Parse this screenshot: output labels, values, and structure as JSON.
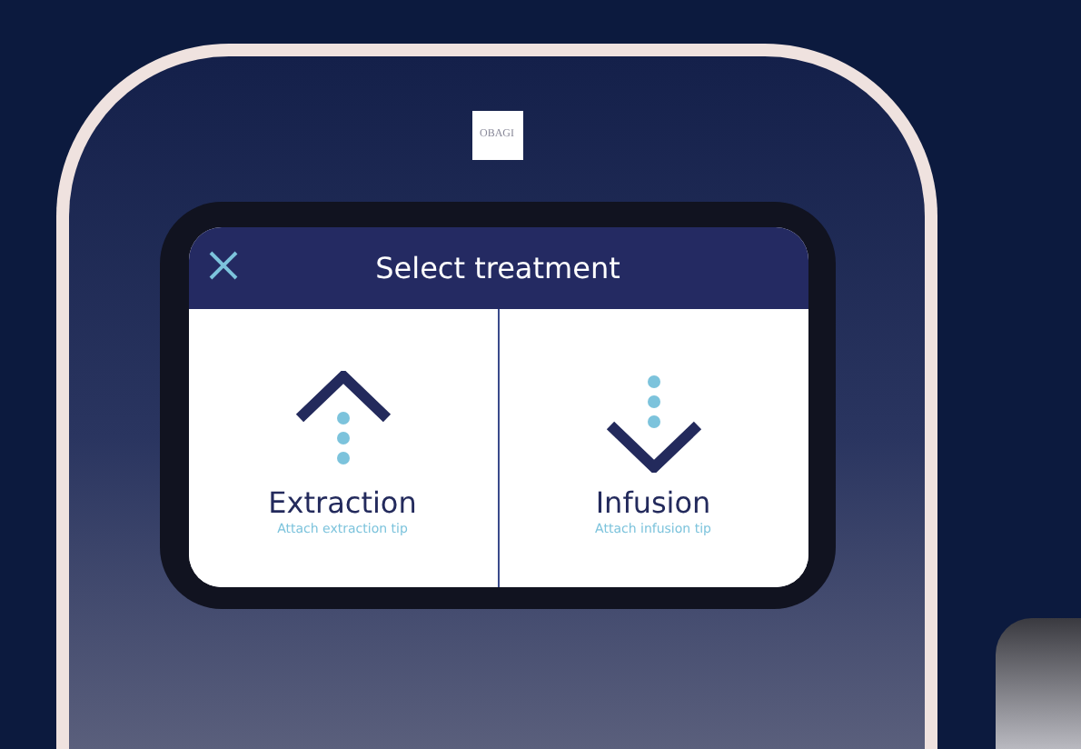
{
  "device": {
    "logo": "OBAGI"
  },
  "screen": {
    "title": "Select treatment",
    "options": [
      {
        "kind": "extraction",
        "label": "Extraction",
        "hint": "Attach extraction tip"
      },
      {
        "kind": "infusion",
        "label": "Infusion",
        "hint": "Attach infusion tip"
      }
    ]
  }
}
